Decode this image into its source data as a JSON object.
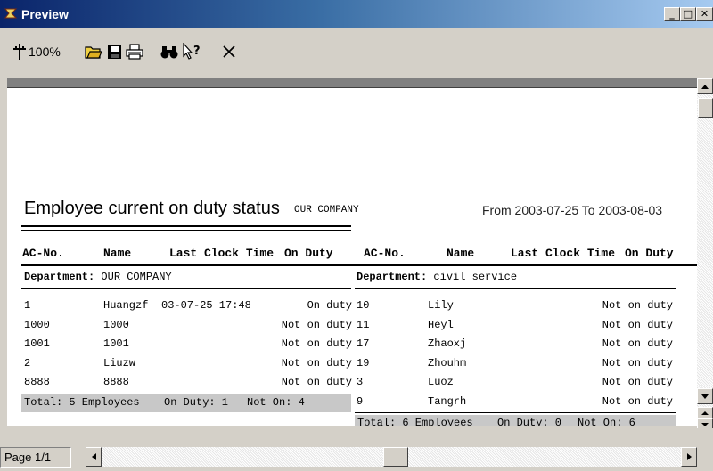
{
  "window": {
    "title": "Preview"
  },
  "toolbar": {
    "zoom": "100%"
  },
  "status": {
    "page": "Page 1/1"
  },
  "report": {
    "title": "Employee current on duty status",
    "company": "OUR COMPANY",
    "range": "From 2003-07-25 To 2003-08-03",
    "headers": {
      "acno": "AC-No.",
      "name": "Name",
      "last": "Last Clock Time",
      "duty": "On Duty"
    },
    "dept_label": "Department:",
    "left": {
      "dept": "OUR COMPANY",
      "rows": [
        {
          "acno": "1",
          "name": "Huangzf",
          "time": "03-07-25 17:48",
          "status": "On duty"
        },
        {
          "acno": "1000",
          "name": "1000",
          "time": "",
          "status": "Not on duty"
        },
        {
          "acno": "1001",
          "name": "1001",
          "time": "",
          "status": "Not on duty"
        },
        {
          "acno": "2",
          "name": "Liuzw",
          "time": "",
          "status": "Not on duty"
        },
        {
          "acno": "8888",
          "name": "8888",
          "time": "",
          "status": "Not on duty"
        }
      ],
      "total": {
        "employees": "Total: 5 Employees",
        "on": "On Duty: 1",
        "not": "Not On: 4"
      }
    },
    "right": {
      "dept": "civil service",
      "rows": [
        {
          "acno": "10",
          "name": "Lily",
          "time": "",
          "status": "Not on duty"
        },
        {
          "acno": "11",
          "name": "Heyl",
          "time": "",
          "status": "Not on duty"
        },
        {
          "acno": "17",
          "name": "Zhaoxj",
          "time": "",
          "status": "Not on duty"
        },
        {
          "acno": "19",
          "name": "Zhouhm",
          "time": "",
          "status": "Not on duty"
        },
        {
          "acno": "3",
          "name": "Luoz",
          "time": "",
          "status": "Not on duty"
        },
        {
          "acno": "9",
          "name": "Tangrh",
          "time": "",
          "status": "Not on duty"
        }
      ],
      "total": {
        "employees": "Total: 6 Employees",
        "on": "On Duty: 0",
        "not": "Not On: 6"
      }
    }
  }
}
